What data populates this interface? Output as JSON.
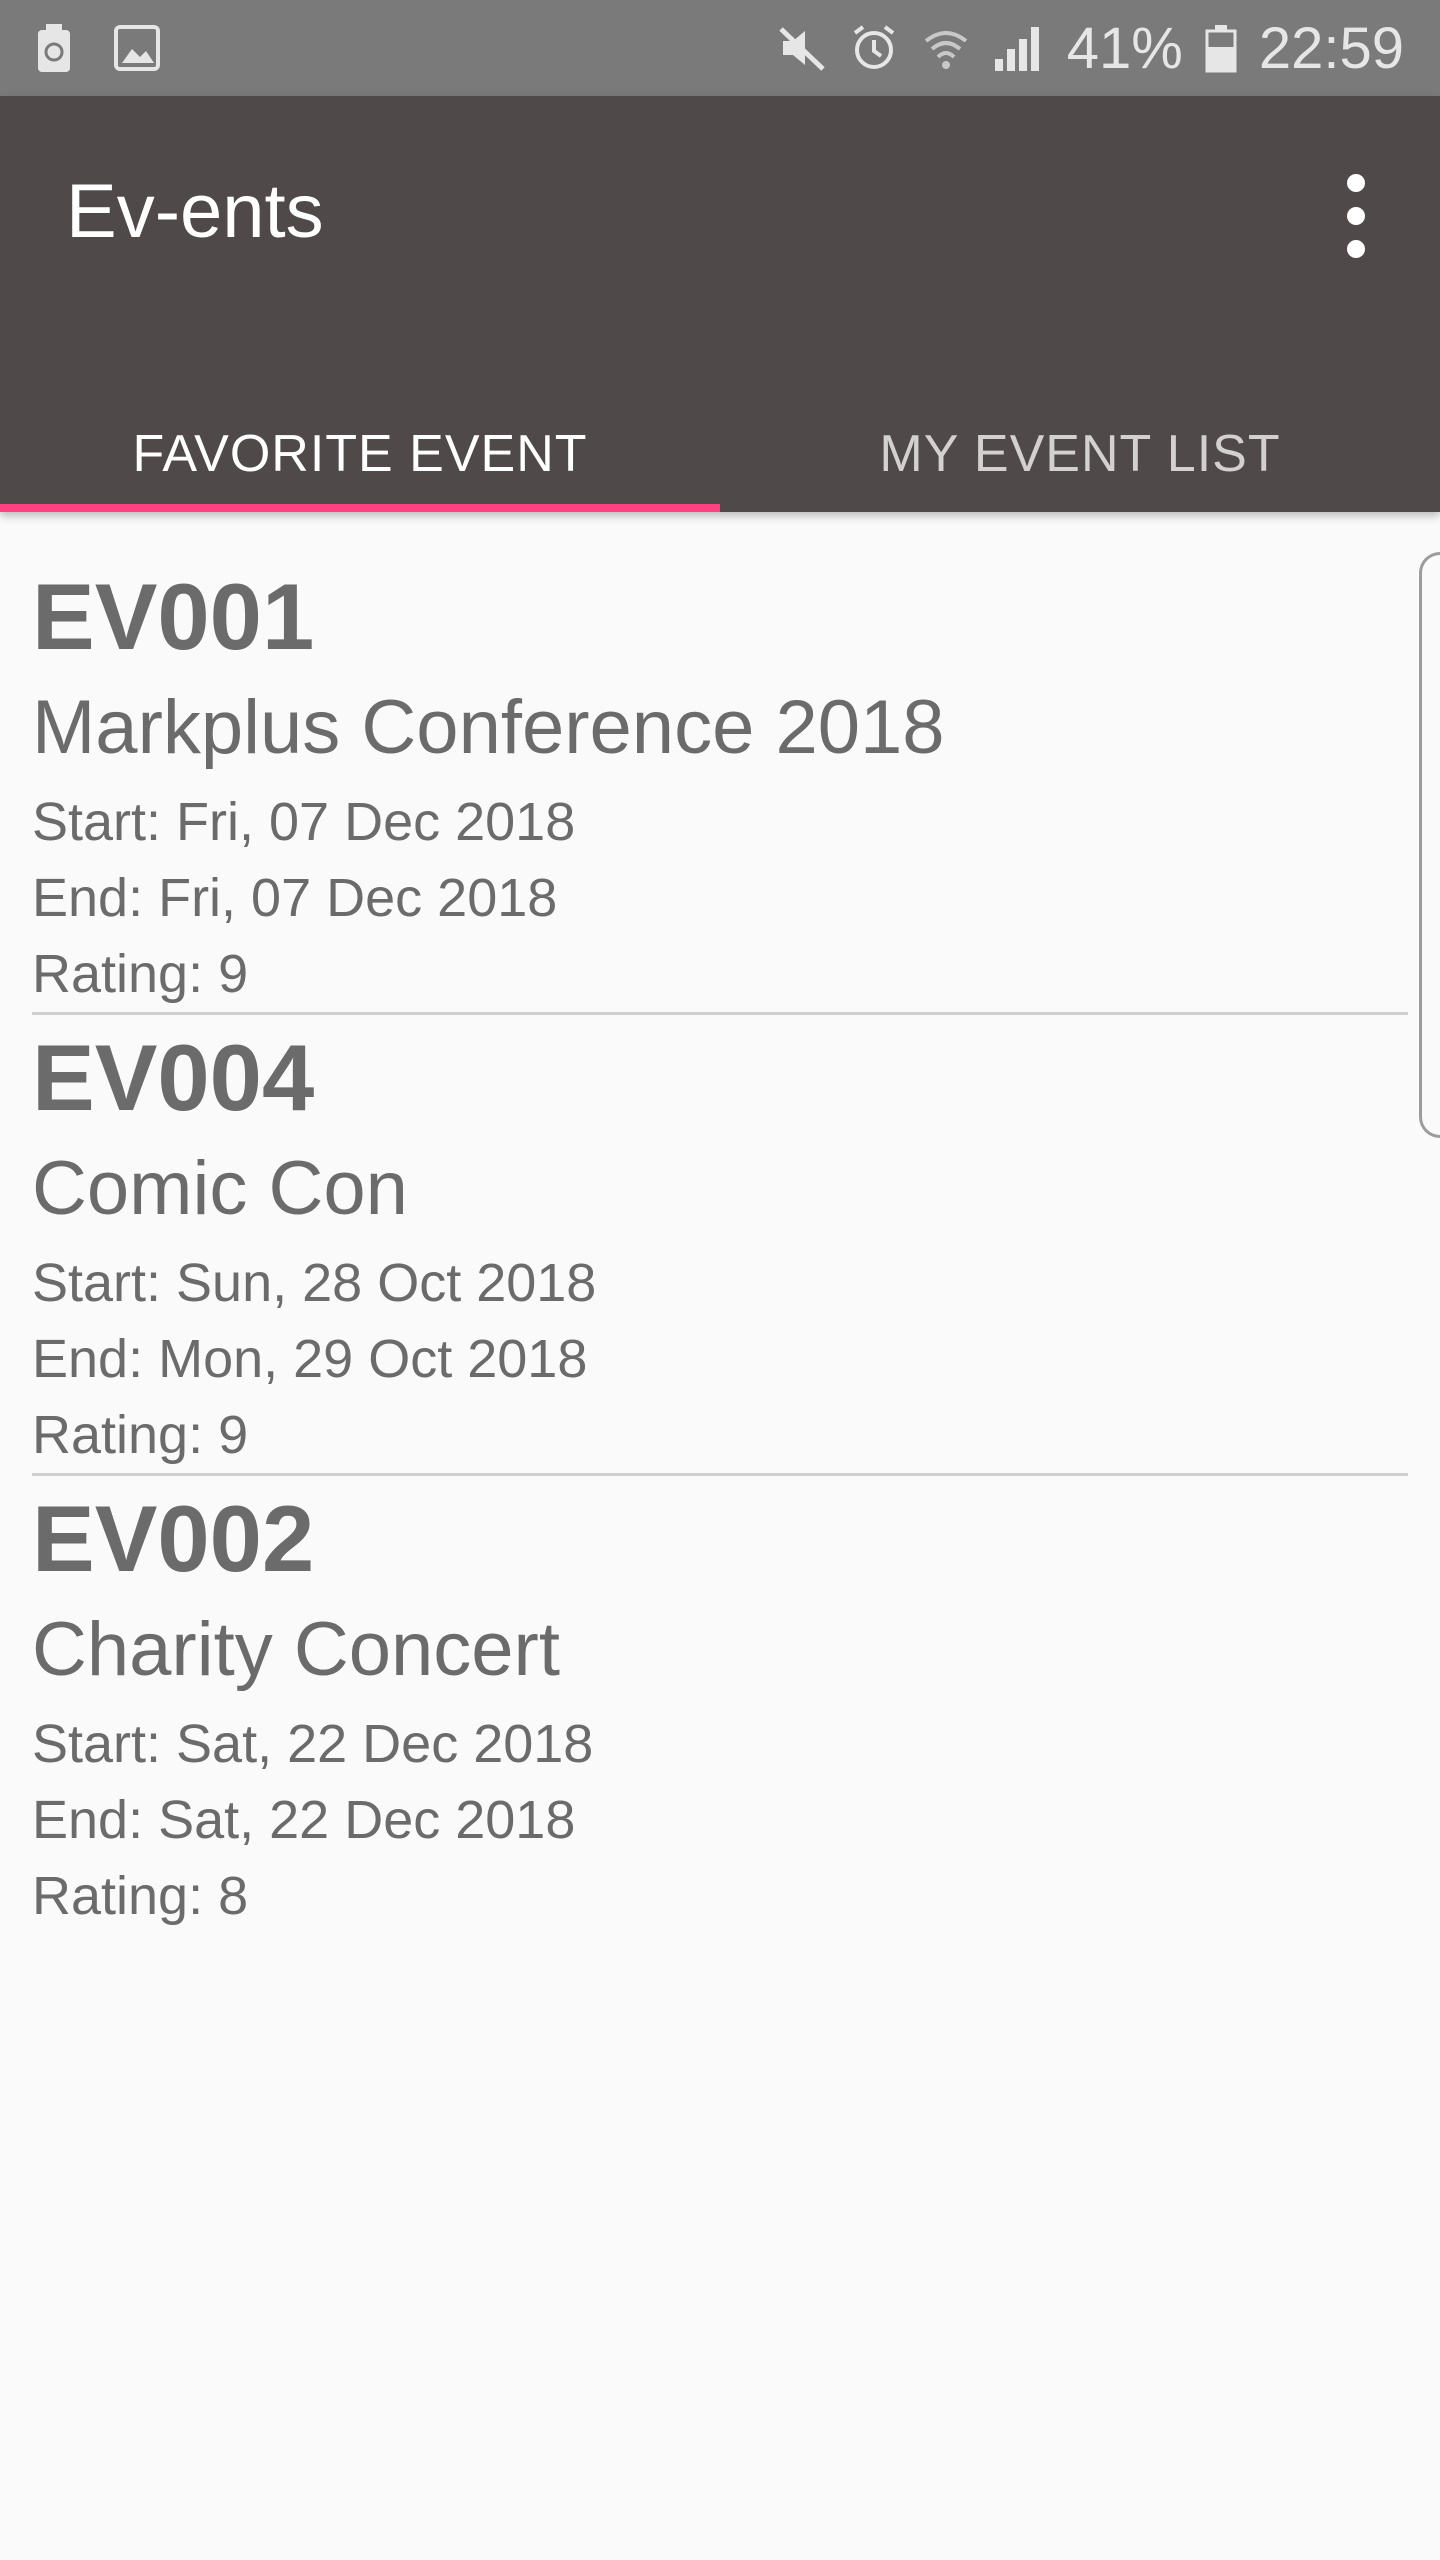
{
  "status_bar": {
    "battery_percent": "41%",
    "time": "22:59",
    "icons": [
      "storage-icon",
      "image-icon",
      "mute-icon",
      "alarm-icon",
      "wifi-icon",
      "signal-icon",
      "battery-icon"
    ]
  },
  "app_bar": {
    "title": "Ev-ents",
    "menu_icon": "overflow-menu-icon"
  },
  "tabs": [
    {
      "label": "FAVORITE EVENT",
      "active": true
    },
    {
      "label": "MY EVENT LIST",
      "active": false
    }
  ],
  "events": [
    {
      "code": "EV001",
      "name": "Markplus Conference 2018",
      "start": "Start: Fri, 07 Dec 2018",
      "end": "End: Fri, 07 Dec 2018",
      "rating": "Rating: 9"
    },
    {
      "code": "EV004",
      "name": "Comic Con",
      "start": "Start: Sun, 28 Oct 2018",
      "end": "End: Mon, 29 Oct 2018",
      "rating": "Rating: 9"
    },
    {
      "code": "EV002",
      "name": "Charity Concert",
      "start": "Start: Sat, 22 Dec 2018",
      "end": "End: Sat, 22 Dec 2018",
      "rating": "Rating: 8"
    }
  ],
  "colors": {
    "status_bar": "#7a7a7a",
    "app_bar": "#4f4949",
    "accent": "#ff4081",
    "text": "#6b6b6b",
    "background": "#fafafa"
  }
}
